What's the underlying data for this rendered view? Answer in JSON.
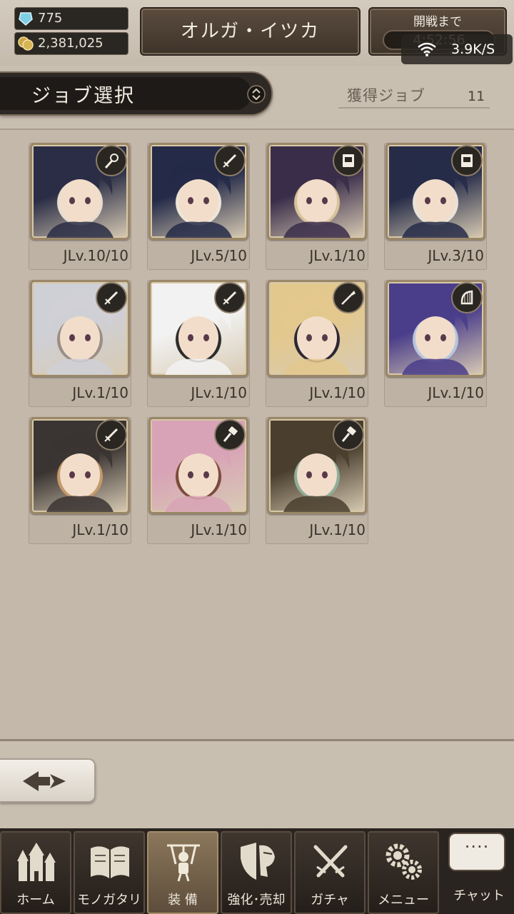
{
  "header": {
    "gems": "775",
    "coins": "2,381,025",
    "character_name": "オルガ・イツカ",
    "battle_label": "開戦まで",
    "battle_timer": "4:52:56",
    "net_speed": "3.9K/S"
  },
  "job_select": {
    "title": "ジョブ選択",
    "acquired_label": "獲得ジョブ",
    "acquired_count": "11"
  },
  "jobs": [
    {
      "level": "JLv.10/10",
      "weapon": "staff-icon",
      "palette": [
        "#2a2d45",
        "#e8ddd0"
      ]
    },
    {
      "level": "JLv.5/10",
      "weapon": "sword-icon",
      "palette": [
        "#242a48",
        "#efe6da"
      ]
    },
    {
      "level": "JLv.1/10",
      "weapon": "tome-icon",
      "palette": [
        "#3a2d4a",
        "#d8c39a"
      ]
    },
    {
      "level": "JLv.3/10",
      "weapon": "tome-icon",
      "palette": [
        "#262c48",
        "#e8e2da"
      ]
    },
    {
      "level": "JLv.1/10",
      "weapon": "sword-icon",
      "palette": [
        "#cfcfd6",
        "#9a8f86"
      ]
    },
    {
      "level": "JLv.1/10",
      "weapon": "sword-icon",
      "palette": [
        "#f2f2f2",
        "#2b2b2b"
      ]
    },
    {
      "level": "JLv.1/10",
      "weapon": "spear-icon",
      "palette": [
        "#e3c88d",
        "#2c2634"
      ]
    },
    {
      "level": "JLv.1/10",
      "weapon": "harp-icon",
      "palette": [
        "#4a3d8a",
        "#b7c6df"
      ]
    },
    {
      "level": "JLv.1/10",
      "weapon": "sword-icon",
      "palette": [
        "#3a3432",
        "#c49a6c"
      ]
    },
    {
      "level": "JLv.1/10",
      "weapon": "hammer-icon",
      "palette": [
        "#d8a3b6",
        "#7a4a3c"
      ]
    },
    {
      "level": "JLv.1/10",
      "weapon": "hammer-icon",
      "palette": [
        "#4a3e2e",
        "#8fae9a"
      ]
    }
  ],
  "nav": {
    "home": "ホーム",
    "story": "モノガタリ",
    "equip": "装 備",
    "enhance": "強化･売却",
    "gacha": "ガチャ",
    "menu": "メニュー",
    "chat": "チャット",
    "chat_bubble": "····"
  }
}
